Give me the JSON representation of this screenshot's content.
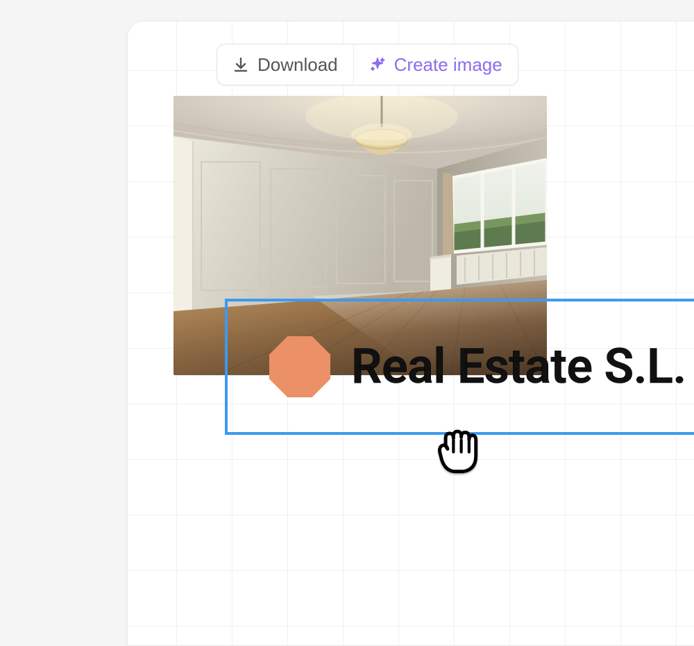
{
  "toolbar": {
    "download_label": "Download",
    "create_image_label": "Create image"
  },
  "text_object": {
    "label": "Real Estate S.L.",
    "bullet_color": "#ec9067"
  },
  "selection": {
    "border_color": "#3c9af0"
  },
  "colors": {
    "accent_purple": "#8c6cf0",
    "panel_bg": "#ffffff",
    "page_bg": "#f5f5f5",
    "grid_line": "#f0f0f0"
  }
}
